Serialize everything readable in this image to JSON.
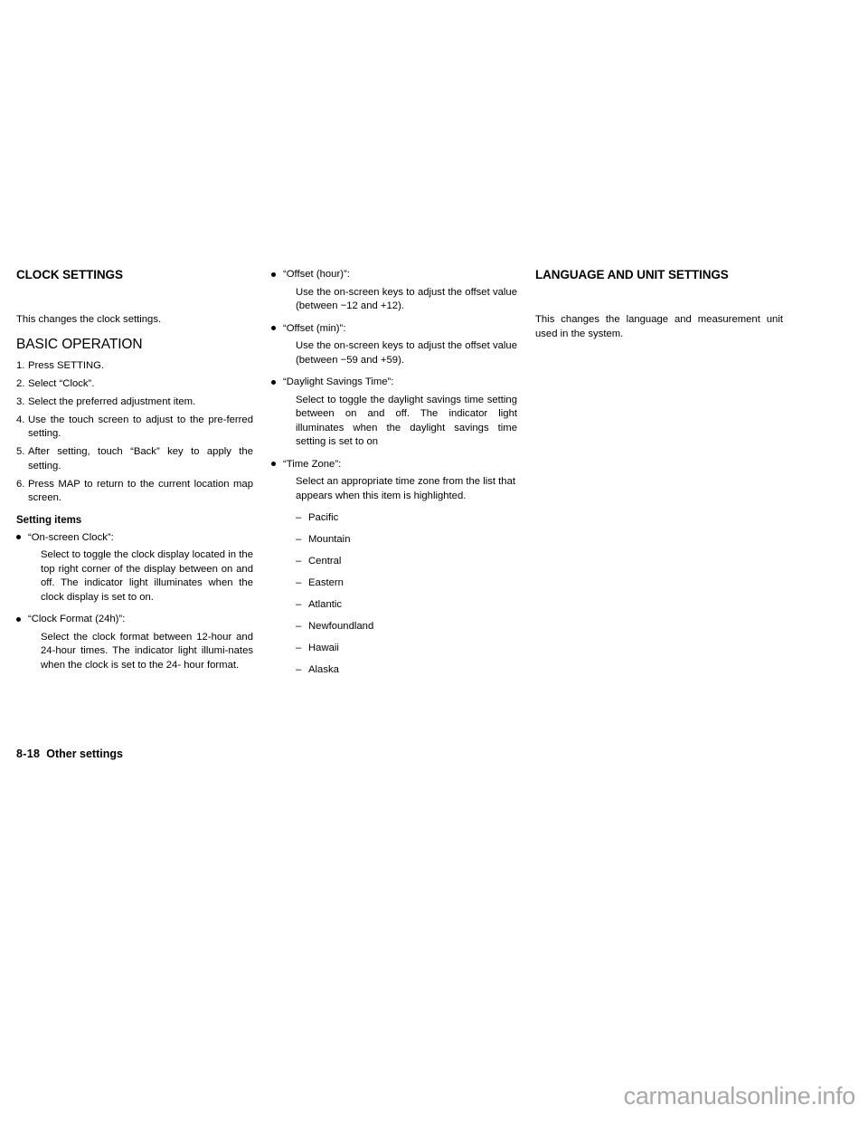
{
  "page": {
    "footer_page_number": "8-18",
    "footer_title": "Other settings",
    "watermark": "carmanualsonline.info"
  },
  "column_left": {
    "section_heading": "CLOCK SETTINGS",
    "intro": "This changes the clock settings.",
    "sub_heading": "BASIC OPERATION",
    "steps": [
      {
        "number": "1.",
        "text": "Press SETTING."
      },
      {
        "number": "2.",
        "text": "Select “Clock”."
      },
      {
        "number": "3.",
        "text": "Select the preferred adjustment item."
      },
      {
        "number": "4.",
        "text": "Use the touch screen to adjust to the pre-ferred setting."
      },
      {
        "number": "5.",
        "text": "After setting, touch “Back” key to apply the setting."
      },
      {
        "number": "6.",
        "text": "Press MAP to return to the current location map screen."
      }
    ],
    "setting_items_heading": "Setting items",
    "items": [
      {
        "label": "“On-screen Clock”:",
        "body": "Select to toggle the clock display located in the top right corner of the display between on and off. The indicator light illuminates when the clock display is set to on."
      },
      {
        "label": "“Clock Format (24h)”:",
        "body": "Select the clock format between 12-hour and 24-hour times. The indicator light illumi-nates when the clock is set to the 24- hour format."
      }
    ]
  },
  "column_middle": {
    "items": [
      {
        "label": "“Offset (hour)”:",
        "body": "Use the on-screen keys to adjust the offset value (between −12 and +12)."
      },
      {
        "label": "“Offset (min)”:",
        "body": "Use the on-screen keys to adjust the offset value (between −59 and +59)."
      },
      {
        "label": "“Daylight Savings Time”:",
        "body": "Select to toggle the daylight savings time setting between on and off. The indicator light illuminates when the daylight savings time setting is set to on"
      },
      {
        "label": "“Time Zone”:",
        "body": "Select an appropriate time zone from the list that appears when this item is highlighted."
      }
    ],
    "time_zones": [
      "Pacific",
      "Mountain",
      "Central",
      "Eastern",
      "Atlantic",
      "Newfoundland",
      "Hawaii",
      "Alaska"
    ]
  },
  "column_right": {
    "section_heading": "LANGUAGE AND UNIT SETTINGS",
    "intro": "This changes the language and measurement unit used in the system."
  }
}
